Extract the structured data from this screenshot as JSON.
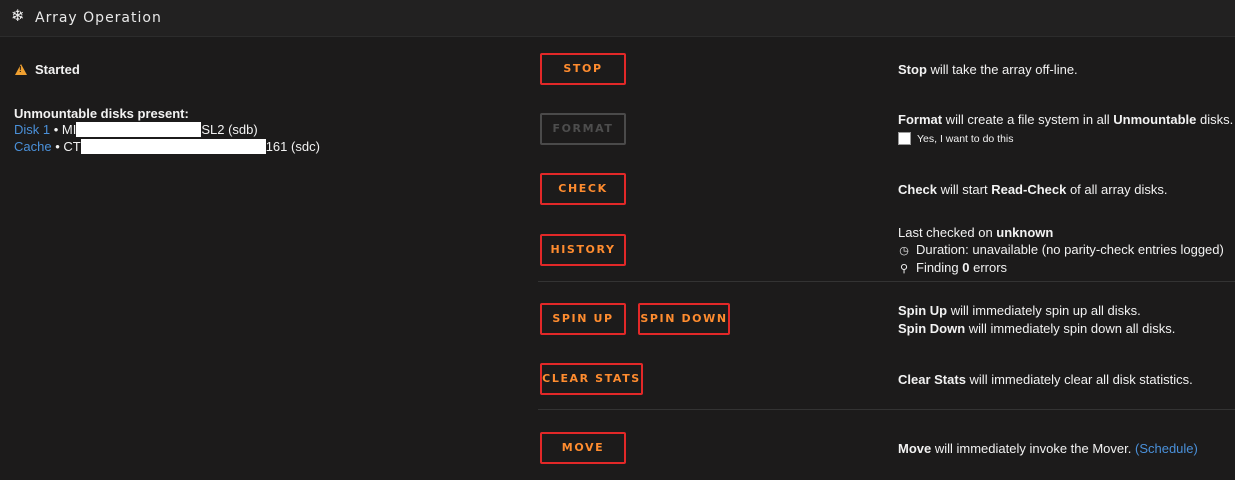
{
  "header": {
    "icon": "snowflake-icon",
    "title": "Array Operation"
  },
  "status": {
    "icon": "warning-icon",
    "label": "Started"
  },
  "unmountable": {
    "title": "Unmountable disks present:",
    "disks": [
      {
        "link": "Disk 1",
        "sep": " • ",
        "name_start": "MI",
        "name_end": "SL2 (sdb)"
      },
      {
        "link": "Cache",
        "sep": " • ",
        "name_start": "CT",
        "name_end": "161 (sdc)"
      }
    ]
  },
  "buttons": {
    "stop": "STOP",
    "format": "FORMAT",
    "check": "CHECK",
    "history": "HISTORY",
    "spin_up": "SPIN UP",
    "spin_down": "SPIN DOWN",
    "clear_stats": "CLEAR STATS",
    "move": "MOVE"
  },
  "descriptions": {
    "stop": {
      "bold": "Stop",
      "rest": " will take the array off-line."
    },
    "format": {
      "bold": "Format",
      "mid": " will create a file system in all ",
      "bold2": "Unmountable",
      "rest": " disks."
    },
    "format_confirm": "Yes, I want to do this",
    "check": {
      "bold": "Check",
      "mid": " will start ",
      "bold2": "Read-Check",
      "rest": " of all array disks."
    },
    "history": {
      "last_checked_prefix": "Last checked on ",
      "last_checked_value": "unknown",
      "duration": "Duration: unavailable (no parity-check entries logged)",
      "finding_prefix": "Finding ",
      "finding_value": "0",
      "finding_suffix": " errors"
    },
    "spin_up": {
      "bold": "Spin Up",
      "rest": " will immediately spin up all disks."
    },
    "spin_down": {
      "bold": "Spin Down",
      "rest": " will immediately spin down all disks."
    },
    "clear_stats": {
      "bold": "Clear Stats",
      "rest": " will immediately clear all disk statistics."
    },
    "move": {
      "bold": "Move",
      "rest": " will immediately invoke the Mover. ",
      "link": "(Schedule)"
    }
  },
  "colors": {
    "accent_border": "#e22828",
    "accent_text": "#ff8c2f",
    "link": "#4a90d9",
    "warning": "#f0a030"
  }
}
